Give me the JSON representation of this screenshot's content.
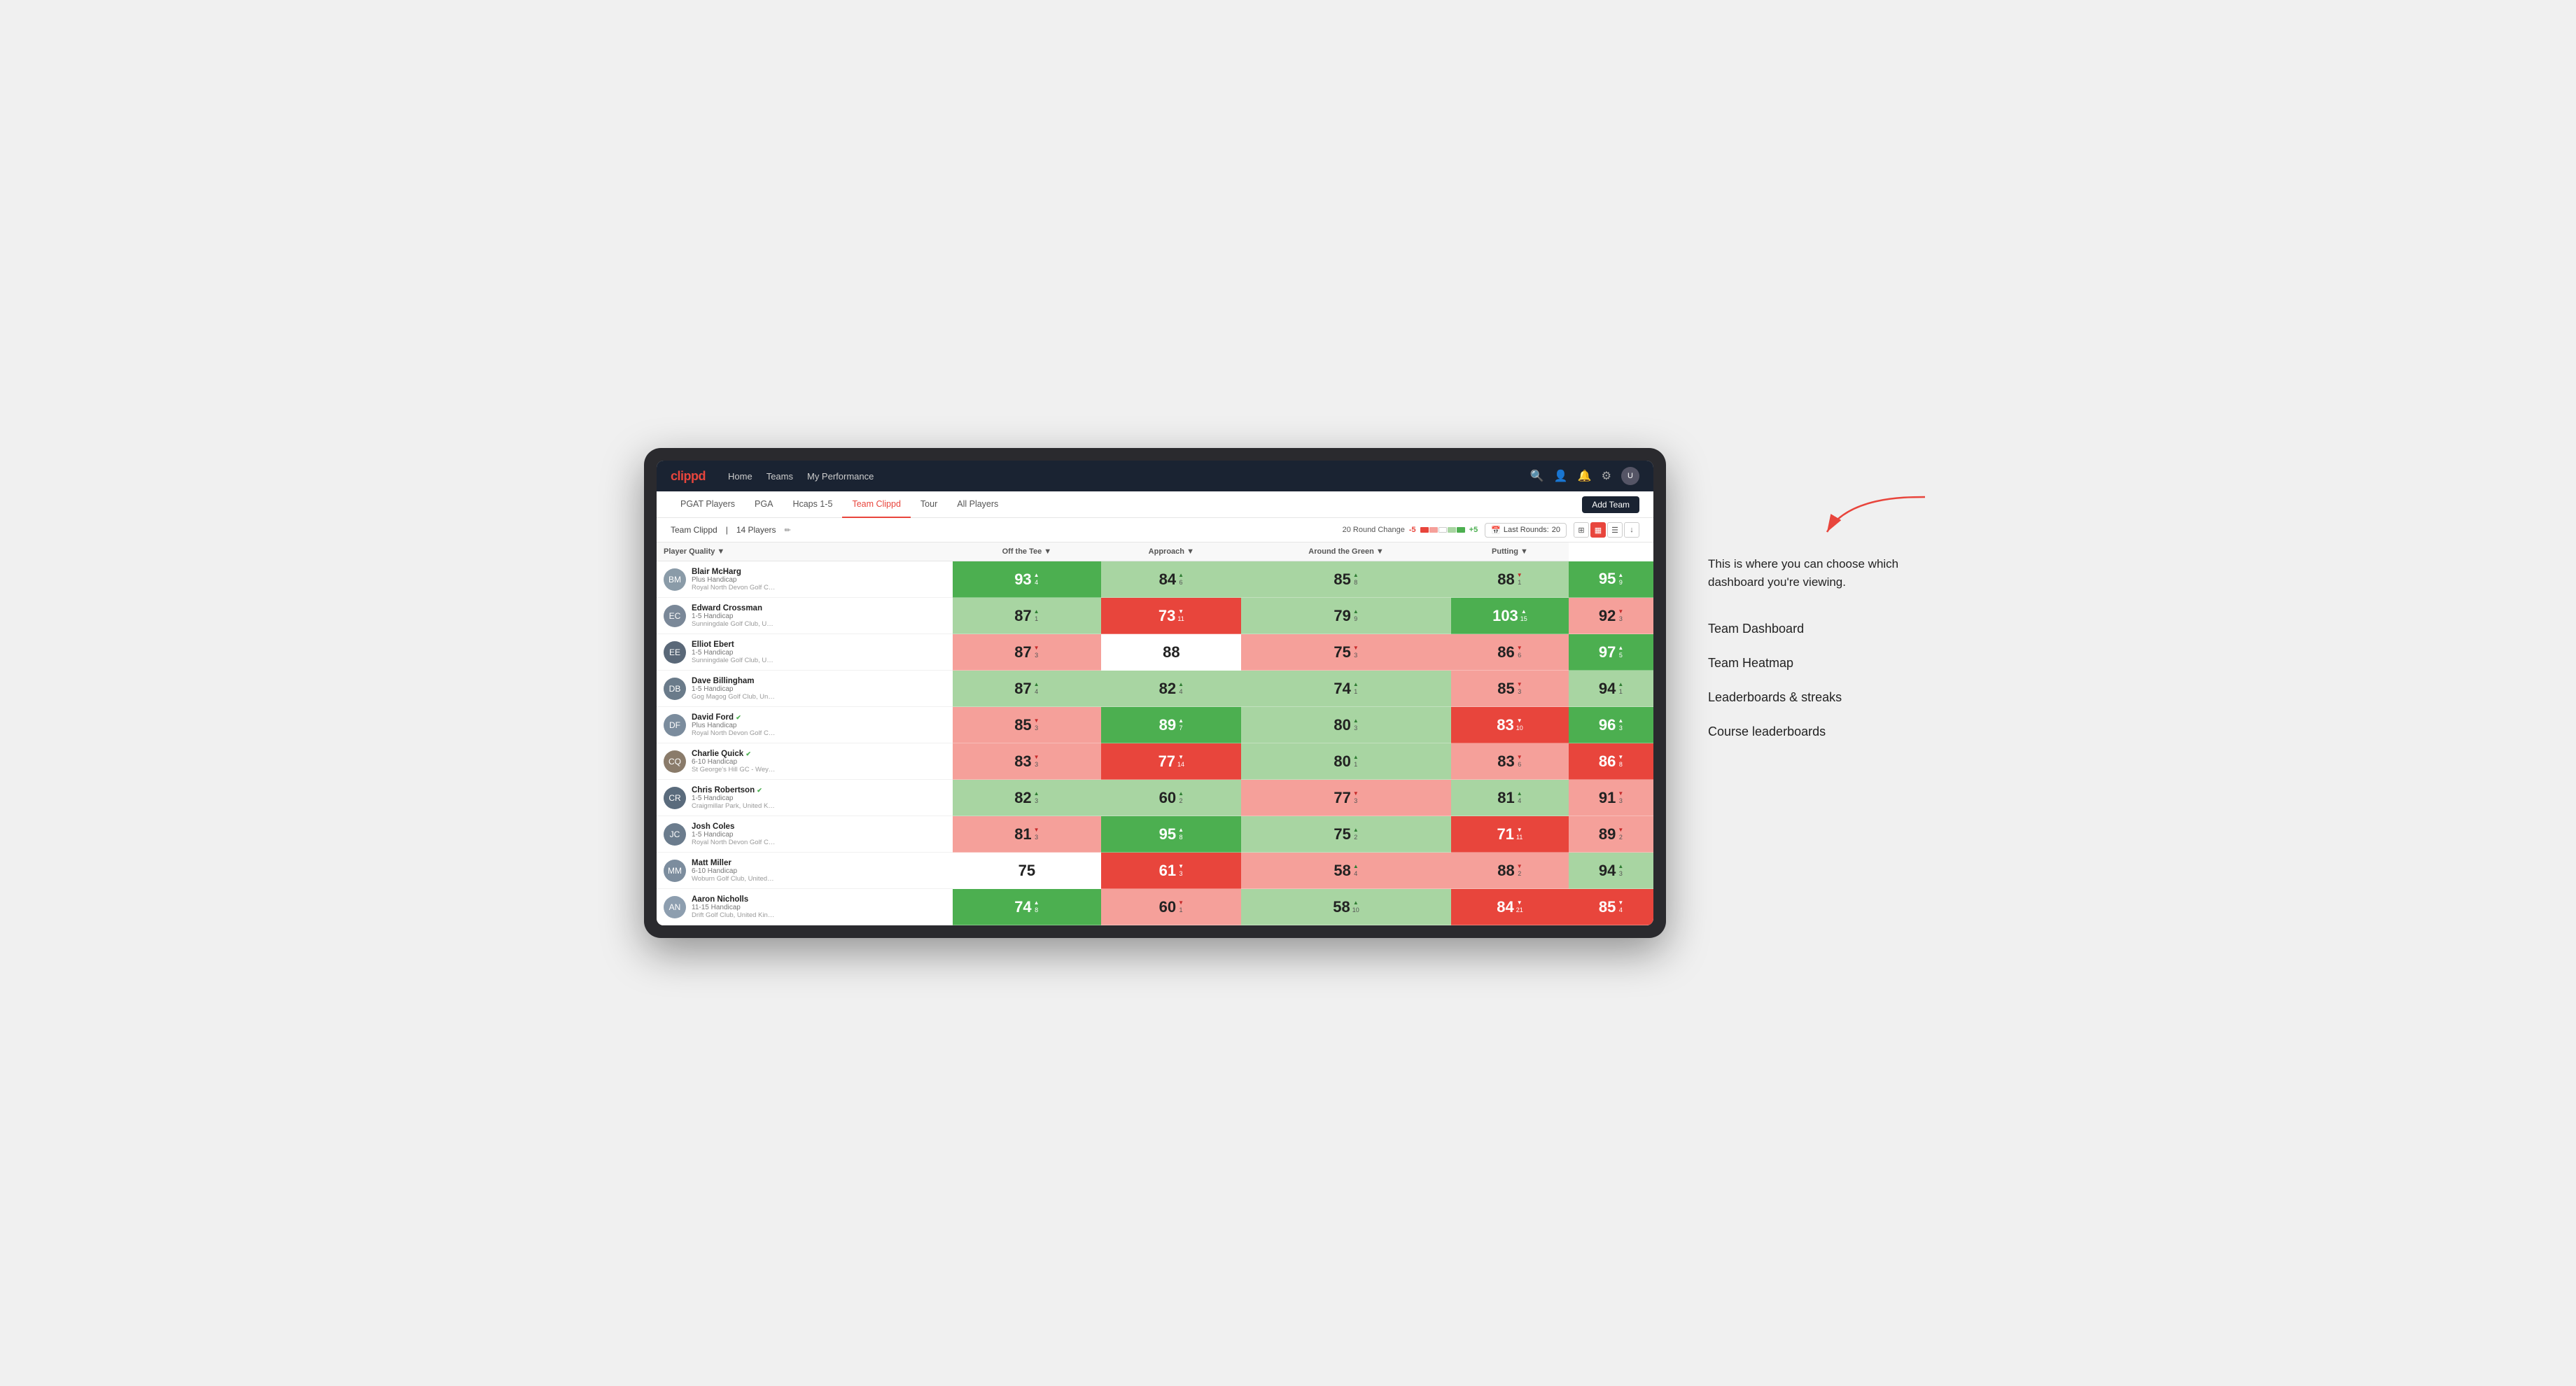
{
  "annotation": {
    "intro_text": "This is where you can choose which dashboard you're viewing.",
    "items": [
      {
        "label": "Team Dashboard"
      },
      {
        "label": "Team Heatmap"
      },
      {
        "label": "Leaderboards & streaks"
      },
      {
        "label": "Course leaderboards"
      }
    ]
  },
  "nav": {
    "logo": "clippd",
    "links": [
      {
        "label": "Home",
        "active": false
      },
      {
        "label": "Teams",
        "active": false
      },
      {
        "label": "My Performance",
        "active": false
      }
    ],
    "add_team": "Add Team"
  },
  "sub_nav": {
    "links": [
      {
        "label": "PGAT Players"
      },
      {
        "label": "PGA"
      },
      {
        "label": "Hcaps 1-5"
      },
      {
        "label": "Team Clippd",
        "active": true
      },
      {
        "label": "Tour"
      },
      {
        "label": "All Players"
      }
    ]
  },
  "team_bar": {
    "name": "Team Clippd",
    "player_count": "14 Players",
    "round_change_label": "20 Round Change",
    "neg_change": "-5",
    "pos_change": "+5",
    "last_rounds_label": "Last Rounds:",
    "last_rounds_value": "20"
  },
  "table": {
    "col_headers": [
      {
        "label": "Player Quality ▼",
        "metric": false
      },
      {
        "label": "Off the Tee ▼",
        "metric": true
      },
      {
        "label": "Approach ▼",
        "metric": true
      },
      {
        "label": "Around the Green ▼",
        "metric": true
      },
      {
        "label": "Putting ▼",
        "metric": true
      }
    ],
    "players": [
      {
        "name": "Blair McHarg",
        "handicap": "Plus Handicap",
        "club": "Royal North Devon Golf Club, United Kingdom",
        "avatar_initials": "BM",
        "avatar_color": "#8a9ba8",
        "metrics": [
          {
            "value": "93",
            "change": "4",
            "direction": "up",
            "color": "green-dark"
          },
          {
            "value": "84",
            "change": "6",
            "direction": "up",
            "color": "green-light"
          },
          {
            "value": "85",
            "change": "8",
            "direction": "up",
            "color": "green-light"
          },
          {
            "value": "88",
            "change": "1",
            "direction": "down",
            "color": "green-light"
          },
          {
            "value": "95",
            "change": "9",
            "direction": "up",
            "color": "green-dark"
          }
        ]
      },
      {
        "name": "Edward Crossman",
        "handicap": "1-5 Handicap",
        "club": "Sunningdale Golf Club, United Kingdom",
        "avatar_initials": "EC",
        "avatar_color": "#7a8898",
        "metrics": [
          {
            "value": "87",
            "change": "1",
            "direction": "up",
            "color": "green-light"
          },
          {
            "value": "73",
            "change": "11",
            "direction": "down",
            "color": "red-dark"
          },
          {
            "value": "79",
            "change": "9",
            "direction": "up",
            "color": "green-light"
          },
          {
            "value": "103",
            "change": "15",
            "direction": "up",
            "color": "green-dark"
          },
          {
            "value": "92",
            "change": "3",
            "direction": "down",
            "color": "red-light"
          }
        ]
      },
      {
        "name": "Elliot Ebert",
        "handicap": "1-5 Handicap",
        "club": "Sunningdale Golf Club, United Kingdom",
        "avatar_initials": "EE",
        "avatar_color": "#5a6878",
        "metrics": [
          {
            "value": "87",
            "change": "3",
            "direction": "down",
            "color": "red-light"
          },
          {
            "value": "88",
            "change": "",
            "direction": "",
            "color": "white"
          },
          {
            "value": "75",
            "change": "3",
            "direction": "down",
            "color": "red-light"
          },
          {
            "value": "86",
            "change": "6",
            "direction": "down",
            "color": "red-light"
          },
          {
            "value": "97",
            "change": "5",
            "direction": "up",
            "color": "green-dark"
          }
        ]
      },
      {
        "name": "Dave Billingham",
        "handicap": "1-5 Handicap",
        "club": "Gog Magog Golf Club, United Kingdom",
        "avatar_initials": "DB",
        "avatar_color": "#6a7b8a",
        "metrics": [
          {
            "value": "87",
            "change": "4",
            "direction": "up",
            "color": "green-light"
          },
          {
            "value": "82",
            "change": "4",
            "direction": "up",
            "color": "green-light"
          },
          {
            "value": "74",
            "change": "1",
            "direction": "up",
            "color": "green-light"
          },
          {
            "value": "85",
            "change": "3",
            "direction": "down",
            "color": "red-light"
          },
          {
            "value": "94",
            "change": "1",
            "direction": "up",
            "color": "green-light"
          }
        ]
      },
      {
        "name": "David Ford",
        "handicap": "Plus Handicap",
        "club": "Royal North Devon Golf Club, United Kingdom",
        "avatar_initials": "DF",
        "avatar_color": "#7b8c9d",
        "verified": true,
        "metrics": [
          {
            "value": "85",
            "change": "3",
            "direction": "down",
            "color": "red-light"
          },
          {
            "value": "89",
            "change": "7",
            "direction": "up",
            "color": "green-dark"
          },
          {
            "value": "80",
            "change": "3",
            "direction": "up",
            "color": "green-light"
          },
          {
            "value": "83",
            "change": "10",
            "direction": "down",
            "color": "red-dark"
          },
          {
            "value": "96",
            "change": "3",
            "direction": "up",
            "color": "green-dark"
          }
        ]
      },
      {
        "name": "Charlie Quick",
        "handicap": "6-10 Handicap",
        "club": "St George's Hill GC - Weybridge - Surrey, Uni...",
        "avatar_initials": "CQ",
        "avatar_color": "#8a7b6a",
        "verified": true,
        "metrics": [
          {
            "value": "83",
            "change": "3",
            "direction": "down",
            "color": "red-light"
          },
          {
            "value": "77",
            "change": "14",
            "direction": "down",
            "color": "red-dark"
          },
          {
            "value": "80",
            "change": "1",
            "direction": "up",
            "color": "green-light"
          },
          {
            "value": "83",
            "change": "6",
            "direction": "down",
            "color": "red-light"
          },
          {
            "value": "86",
            "change": "8",
            "direction": "down",
            "color": "red-dark"
          }
        ]
      },
      {
        "name": "Chris Robertson",
        "handicap": "1-5 Handicap",
        "club": "Craigmillar Park, United Kingdom",
        "avatar_initials": "CR",
        "avatar_color": "#5a6b7c",
        "verified": true,
        "metrics": [
          {
            "value": "82",
            "change": "3",
            "direction": "up",
            "color": "green-light"
          },
          {
            "value": "60",
            "change": "2",
            "direction": "up",
            "color": "green-light"
          },
          {
            "value": "77",
            "change": "3",
            "direction": "down",
            "color": "red-light"
          },
          {
            "value": "81",
            "change": "4",
            "direction": "up",
            "color": "green-light"
          },
          {
            "value": "91",
            "change": "3",
            "direction": "down",
            "color": "red-light"
          }
        ]
      },
      {
        "name": "Josh Coles",
        "handicap": "1-5 Handicap",
        "club": "Royal North Devon Golf Club, United Kingdom",
        "avatar_initials": "JC",
        "avatar_color": "#6b7c8d",
        "metrics": [
          {
            "value": "81",
            "change": "3",
            "direction": "down",
            "color": "red-light"
          },
          {
            "value": "95",
            "change": "8",
            "direction": "up",
            "color": "green-dark"
          },
          {
            "value": "75",
            "change": "2",
            "direction": "up",
            "color": "green-light"
          },
          {
            "value": "71",
            "change": "11",
            "direction": "down",
            "color": "red-dark"
          },
          {
            "value": "89",
            "change": "2",
            "direction": "down",
            "color": "red-light"
          }
        ]
      },
      {
        "name": "Matt Miller",
        "handicap": "6-10 Handicap",
        "club": "Woburn Golf Club, United Kingdom",
        "avatar_initials": "MM",
        "avatar_color": "#7c8d9e",
        "metrics": [
          {
            "value": "75",
            "change": "",
            "direction": "",
            "color": "white"
          },
          {
            "value": "61",
            "change": "3",
            "direction": "down",
            "color": "red-dark"
          },
          {
            "value": "58",
            "change": "4",
            "direction": "up",
            "color": "red-light"
          },
          {
            "value": "88",
            "change": "2",
            "direction": "down",
            "color": "red-light"
          },
          {
            "value": "94",
            "change": "3",
            "direction": "up",
            "color": "green-light"
          }
        ]
      },
      {
        "name": "Aaron Nicholls",
        "handicap": "11-15 Handicap",
        "club": "Drift Golf Club, United Kingdom",
        "avatar_initials": "AN",
        "avatar_color": "#8d9eaf",
        "metrics": [
          {
            "value": "74",
            "change": "8",
            "direction": "up",
            "color": "green-dark"
          },
          {
            "value": "60",
            "change": "1",
            "direction": "down",
            "color": "red-light"
          },
          {
            "value": "58",
            "change": "10",
            "direction": "up",
            "color": "green-light"
          },
          {
            "value": "84",
            "change": "21",
            "direction": "down",
            "color": "red-dark"
          },
          {
            "value": "85",
            "change": "4",
            "direction": "down",
            "color": "red-dark"
          }
        ]
      }
    ]
  }
}
